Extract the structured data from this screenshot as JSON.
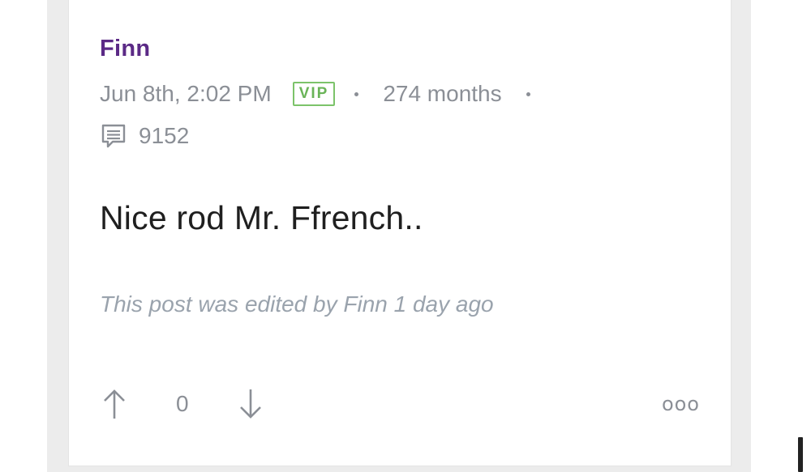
{
  "post": {
    "author": "Finn",
    "date": "Jun 8th, 2:02 PM",
    "badge": "VIP",
    "tenure": "274 months",
    "reply_count": "9152",
    "body": "Nice rod Mr. Ffrench..",
    "edit_note": "This post was edited by Finn 1 day ago",
    "vote_count": "0",
    "more_label": "ooo"
  },
  "icons": {
    "replies": "chat-bubble-icon",
    "upvote": "arrow-up-icon",
    "downvote": "arrow-down-icon",
    "more": "more-options-icon"
  },
  "colors": {
    "author": "#5b2a86",
    "vip": "#6ab458",
    "meta": "#8b8f96",
    "body": "#1f1f1f",
    "edit_note": "#9aa3ad"
  }
}
